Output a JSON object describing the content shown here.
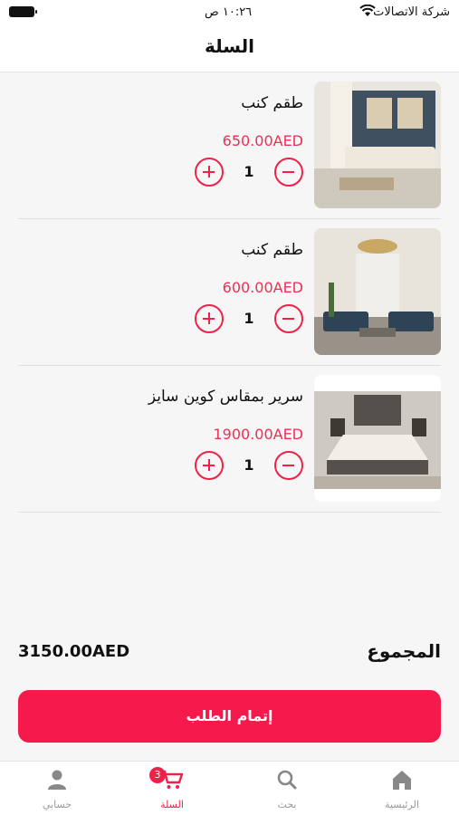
{
  "status_bar": {
    "carrier": "شركة الاتصالات",
    "time": "١٠:٢٦ ص"
  },
  "header": {
    "title": "السلة"
  },
  "cart": {
    "items": [
      {
        "name": "طقم كنب",
        "price": "650.00AED",
        "quantity": "1",
        "image": "living-room-sofa-photo"
      },
      {
        "name": "طقم كنب",
        "price": "600.00AED",
        "quantity": "1",
        "image": "lounge-sofa-set-photo"
      },
      {
        "name": "سرير بمقاس كوين سايز",
        "price": "1900.00AED",
        "quantity": "1",
        "image": "queen-bed-photo"
      }
    ]
  },
  "summary": {
    "total_label": "المجموع",
    "total_value": "3150.00AED"
  },
  "checkout_label": "إتمام الطلب",
  "tabbar": {
    "tabs": [
      {
        "label": "حسابي",
        "icon": "person-icon"
      },
      {
        "label": "السلة",
        "icon": "cart-icon",
        "badge": "3",
        "active": true
      },
      {
        "label": "بحث",
        "icon": "search-icon"
      },
      {
        "label": "الرئيسية",
        "icon": "home-icon"
      }
    ]
  },
  "colors": {
    "accent": "#ee2249",
    "checkout": "#f5194c",
    "price": "#ee2f55"
  }
}
